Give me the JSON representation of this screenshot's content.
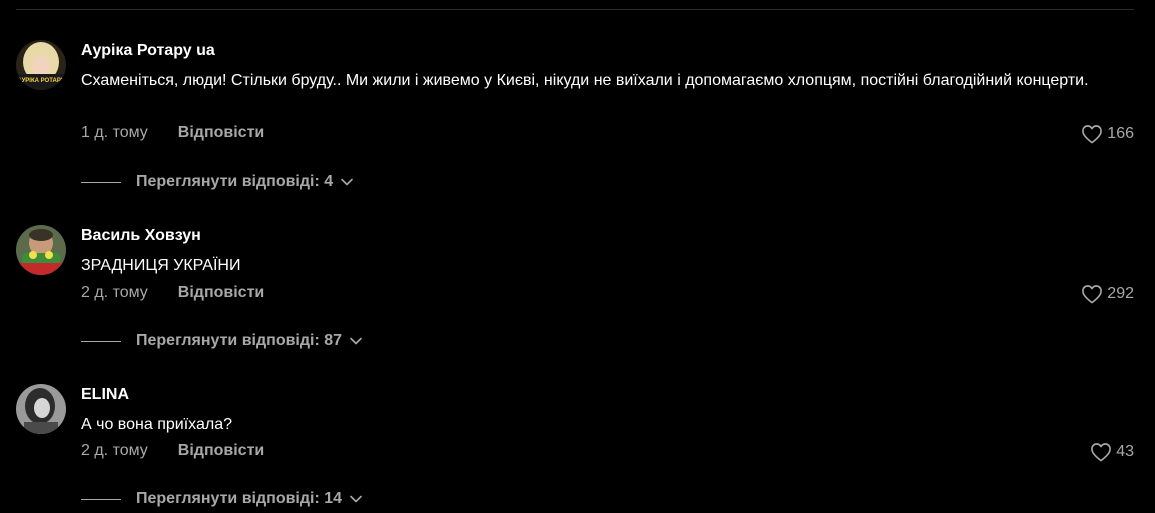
{
  "comments": [
    {
      "username": "Аурiка Ротару ua",
      "avatar_caption": "АУРІКА РОТАРУ",
      "text": "Схаменіться, люди! Стільки бруду.. Ми жили і живемо у Києві, нікуди не виїхали і допомагаємо хлопцям, постійні благодійний концерти.",
      "time": "1 д. тому",
      "reply_label": "Відповісти",
      "likes": "166",
      "replies_label": "Переглянути відповіді: 4"
    },
    {
      "username": "Василь Ховзун",
      "text": "ЗРАДНИЦЯ УКРАЇНИ",
      "time": "2 д. тому",
      "reply_label": "Відповісти",
      "likes": "292",
      "replies_label": "Переглянути відповіді: 87"
    },
    {
      "username": "ELINA",
      "text": "А чо вона приїхала?",
      "time": "2 д. тому",
      "reply_label": "Відповісти",
      "likes": "43",
      "replies_label": "Переглянути відповіді: 14"
    }
  ],
  "icons": {
    "like": "heart-icon",
    "expand": "chevron-down-icon"
  },
  "colors": {
    "background": "#000000",
    "text_primary": "#ffffff",
    "text_secondary": "#a8a8a8"
  }
}
